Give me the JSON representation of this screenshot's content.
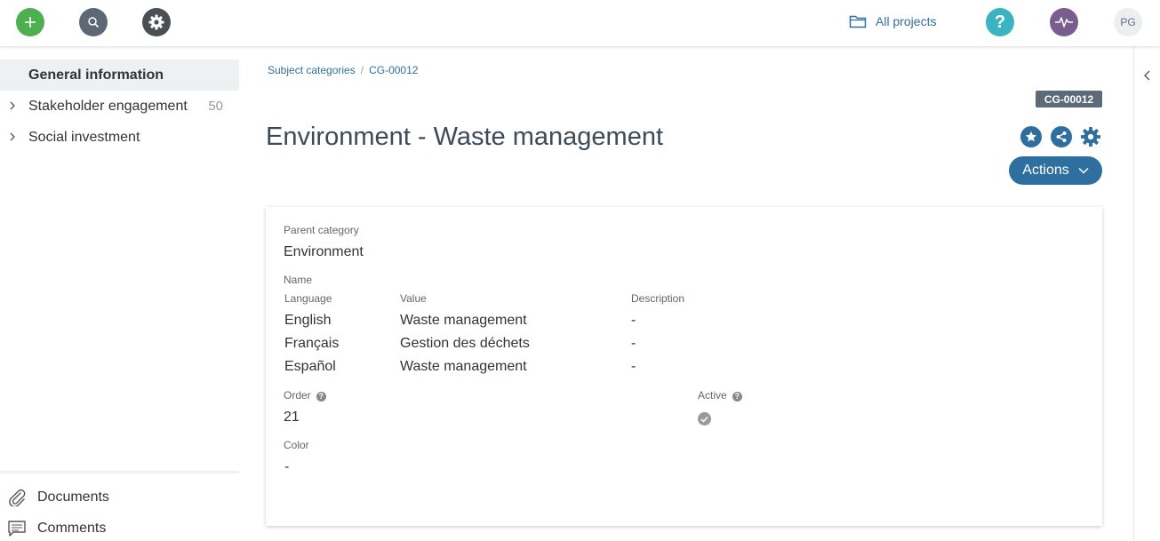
{
  "topbar": {
    "all_projects_label": "All projects",
    "help_label": "?",
    "user_initials": "PG"
  },
  "sidebar": {
    "items": [
      {
        "label": "General information",
        "active": true
      },
      {
        "label": "Stakeholder engagement",
        "count": "50"
      },
      {
        "label": "Social investment"
      }
    ],
    "bottom_items": [
      {
        "label": "Documents",
        "icon": "paperclip-icon"
      },
      {
        "label": "Comments",
        "icon": "comment-icon"
      }
    ]
  },
  "breadcrumb": {
    "items": [
      "Subject categories",
      "CG-00012"
    ],
    "separator": "/"
  },
  "record": {
    "code": "CG-00012",
    "title": "Environment - Waste management",
    "actions_label": "Actions"
  },
  "details": {
    "parent_category_label": "Parent category",
    "parent_category_value": "Environment",
    "name_label": "Name",
    "columns": [
      "Language",
      "Value",
      "Description"
    ],
    "rows": [
      {
        "language": "English",
        "value": "Waste management",
        "description": "-"
      },
      {
        "language": "Français",
        "value": "Gestion des déchets",
        "description": "-"
      },
      {
        "language": "Español",
        "value": "Waste management",
        "description": "-"
      }
    ],
    "order_label": "Order",
    "order_value": "21",
    "active_label": "Active",
    "active_value": true,
    "color_label": "Color",
    "color_value": "-"
  },
  "colors": {
    "accent": "#2f6f9f",
    "add": "#4caf50",
    "help": "#3bb3c0",
    "activity": "#7a5d8f"
  }
}
